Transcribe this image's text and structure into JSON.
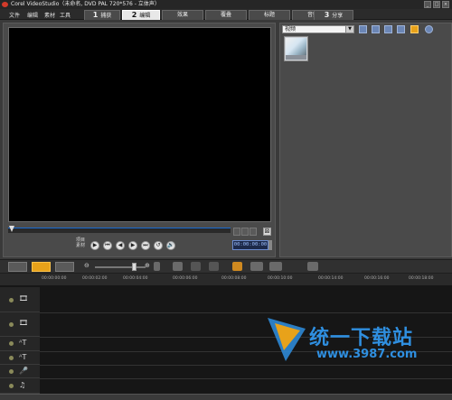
{
  "window": {
    "title": "Corel VideoStudio（未命名, DVD PAL 720*576 - 立体声）",
    "min": "_",
    "max": "□",
    "close": "×"
  },
  "menu": [
    "文件",
    "编辑",
    "素材",
    "工具"
  ],
  "steps": [
    {
      "num": "1",
      "label": "捕获"
    },
    {
      "num": "2",
      "label": "编辑"
    },
    {
      "label": "效果"
    },
    {
      "label": "覆叠"
    },
    {
      "label": "标题"
    },
    {
      "label": "音频"
    },
    {
      "num": "3",
      "label": "分享"
    }
  ],
  "preview": {
    "mode_labels": [
      "项目",
      "素材"
    ],
    "controls": [
      "▶",
      "⏮",
      "◀",
      "▶",
      "⏭",
      "↺",
      "🔊"
    ],
    "timecode": "00:00:00:00",
    "end_marker": "⊠"
  },
  "library": {
    "category": "视频",
    "arrow": "▼"
  },
  "colors": {
    "accent_orange": "#e8a21a",
    "accent_blue": "#2f8fe0",
    "timecode_text": "#9ec0ff"
  },
  "toolbar": {
    "icons": [
      "zoom-out-icon",
      "zoom-in-icon",
      "fit-icon",
      "insert-icon",
      "undo-icon",
      "redo-icon",
      "record-icon",
      "mix-icon",
      "auto-music-icon",
      "export-icon"
    ]
  },
  "ruler": [
    "00:00:00:00",
    "00:00:02:00",
    "00:00:04:00",
    "00:00:06:00",
    "00:00:08:00",
    "00:00:10:00",
    "00:00:12:00",
    "00:00:14:00",
    "00:00:16:00",
    "00:00:18:00"
  ],
  "tracks": [
    {
      "name": "video-track",
      "icon": "🎞"
    },
    {
      "name": "overlay-track",
      "icon": "🎞"
    },
    {
      "name": "title-track",
      "icon": "ᴬT"
    },
    {
      "name": "title-track-2",
      "icon": "ᴬT"
    },
    {
      "name": "voice-track",
      "icon": "🎤"
    },
    {
      "name": "music-track",
      "icon": "♫"
    }
  ],
  "watermark": {
    "title": "统一下载站",
    "url": "www.3987.com"
  }
}
